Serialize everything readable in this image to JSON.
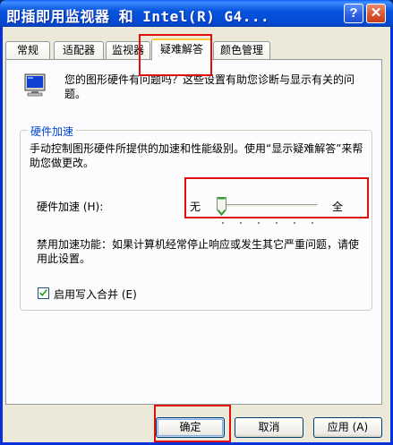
{
  "window": {
    "title": "即插即用监视器 和 Intel(R) G4...",
    "help_label": "?",
    "close_label": "✕"
  },
  "tabs": [
    {
      "label": "常规",
      "active": false
    },
    {
      "label": "适配器",
      "active": false
    },
    {
      "label": "监视器",
      "active": false
    },
    {
      "label": "疑难解答",
      "active": true
    },
    {
      "label": "颜色管理",
      "active": false
    }
  ],
  "troubleshoot": {
    "icon": "monitor-icon",
    "description": "您的图形硬件有问题吗？这些设置有助您诊断与显示有关的问题。"
  },
  "hardware_acceleration": {
    "legend": "硬件加速",
    "description": "手动控制图形硬件所提供的加速和性能级别。使用“显示疑难解答”来帮助您做更改。",
    "slider_label": "硬件加速 (H):",
    "min_label": "无",
    "max_label": "全",
    "slider_level": 0,
    "disable_text": "禁用加速功能：如果计算机经常停止响应或发生其它严重问题，请使用此设置。",
    "write_combining_label": "启用写入合并 (E)",
    "write_combining_checked": true
  },
  "buttons": {
    "ok": "确定",
    "cancel": "取消",
    "apply": "应用 (A)"
  },
  "colors": {
    "title_bar": "#0855dd",
    "window_frame": "#0831d9",
    "dialog_face": "#ece9d8",
    "tab_highlight": "#ffc83c",
    "group_legend": "#0046d5",
    "annotation": "#e01010"
  }
}
